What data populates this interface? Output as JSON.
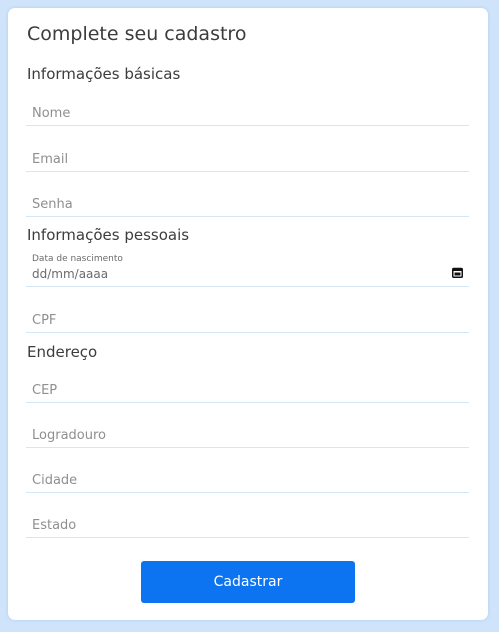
{
  "form": {
    "title": "Complete seu cadastro",
    "sections": {
      "basic": "Informações básicas",
      "personal": "Informações pessoais",
      "address": "Endereço"
    },
    "fields": {
      "name_placeholder": "Nome",
      "email_placeholder": "Email",
      "password_placeholder": "Senha",
      "birthdate_label": "Data de nascimento",
      "birthdate_value": "dd/mm/aaaa",
      "cpf_placeholder": "CPF",
      "cep_placeholder": "CEP",
      "street_placeholder": "Logradouro",
      "city_placeholder": "Cidade",
      "state_placeholder": "Estado"
    },
    "submit_label": "Cadastrar"
  },
  "colors": {
    "background": "#cfe4fb",
    "card": "#ffffff",
    "accent": "#0d74f1",
    "field_border": "#d6e6f2"
  },
  "icons": {
    "date_picker": "calendar-icon"
  }
}
